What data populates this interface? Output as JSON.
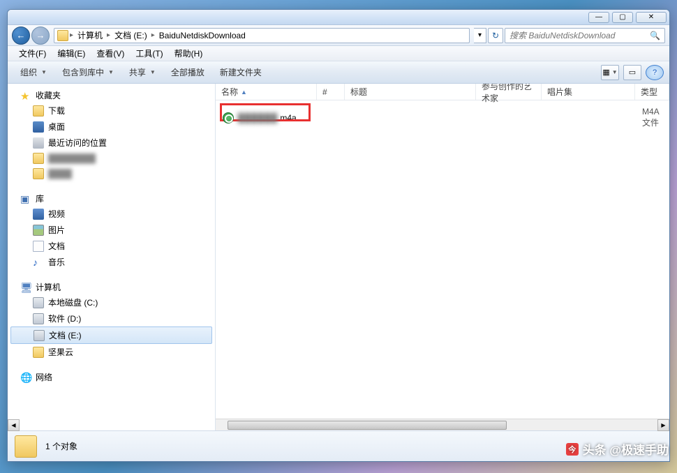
{
  "titlebar": {
    "min": "—",
    "max": "▢",
    "close": "✕"
  },
  "nav": {
    "back": "←",
    "fwd": "→",
    "refresh": "↻",
    "drop": "▾"
  },
  "breadcrumb": {
    "seg1": "计算机",
    "seg2": "文档 (E:)",
    "seg3": "BaiduNetdiskDownload",
    "sep": "▸"
  },
  "search": {
    "placeholder": "搜索 BaiduNetdiskDownload",
    "icon": "🔍"
  },
  "menu": {
    "file": "文件(F)",
    "edit": "编辑(E)",
    "view": "查看(V)",
    "tools": "工具(T)",
    "help": "帮助(H)"
  },
  "toolbar": {
    "organize": "组织",
    "include": "包含到库中",
    "share": "共享",
    "play_all": "全部播放",
    "new_folder": "新建文件夹",
    "view_icon": "▦",
    "preview_icon": "▭",
    "help_icon": "?"
  },
  "sidebar": {
    "favorites": "收藏夹",
    "downloads": "下载",
    "desktop": "桌面",
    "recent": "最近访问的位置",
    "blur1": "████████",
    "blur2": "████",
    "libraries": "库",
    "video": "视频",
    "pictures": "图片",
    "documents": "文档",
    "music": "音乐",
    "computer": "计算机",
    "drive_c": "本地磁盘 (C:)",
    "drive_d": "软件 (D:)",
    "drive_e": "文档 (E:)",
    "jianguo": "坚果云",
    "network": "网络"
  },
  "columns": {
    "name": "名称",
    "num": "#",
    "title": "标题",
    "artist": "参与创作的艺术家",
    "album": "唱片集",
    "type": "类型"
  },
  "file": {
    "name_blur": "██████",
    "name_ext": ".m4a",
    "type_val": "M4A 文件"
  },
  "status": {
    "count": "1 个对象"
  },
  "watermark": {
    "text": "头条 @极速手助",
    "icon": "今"
  }
}
